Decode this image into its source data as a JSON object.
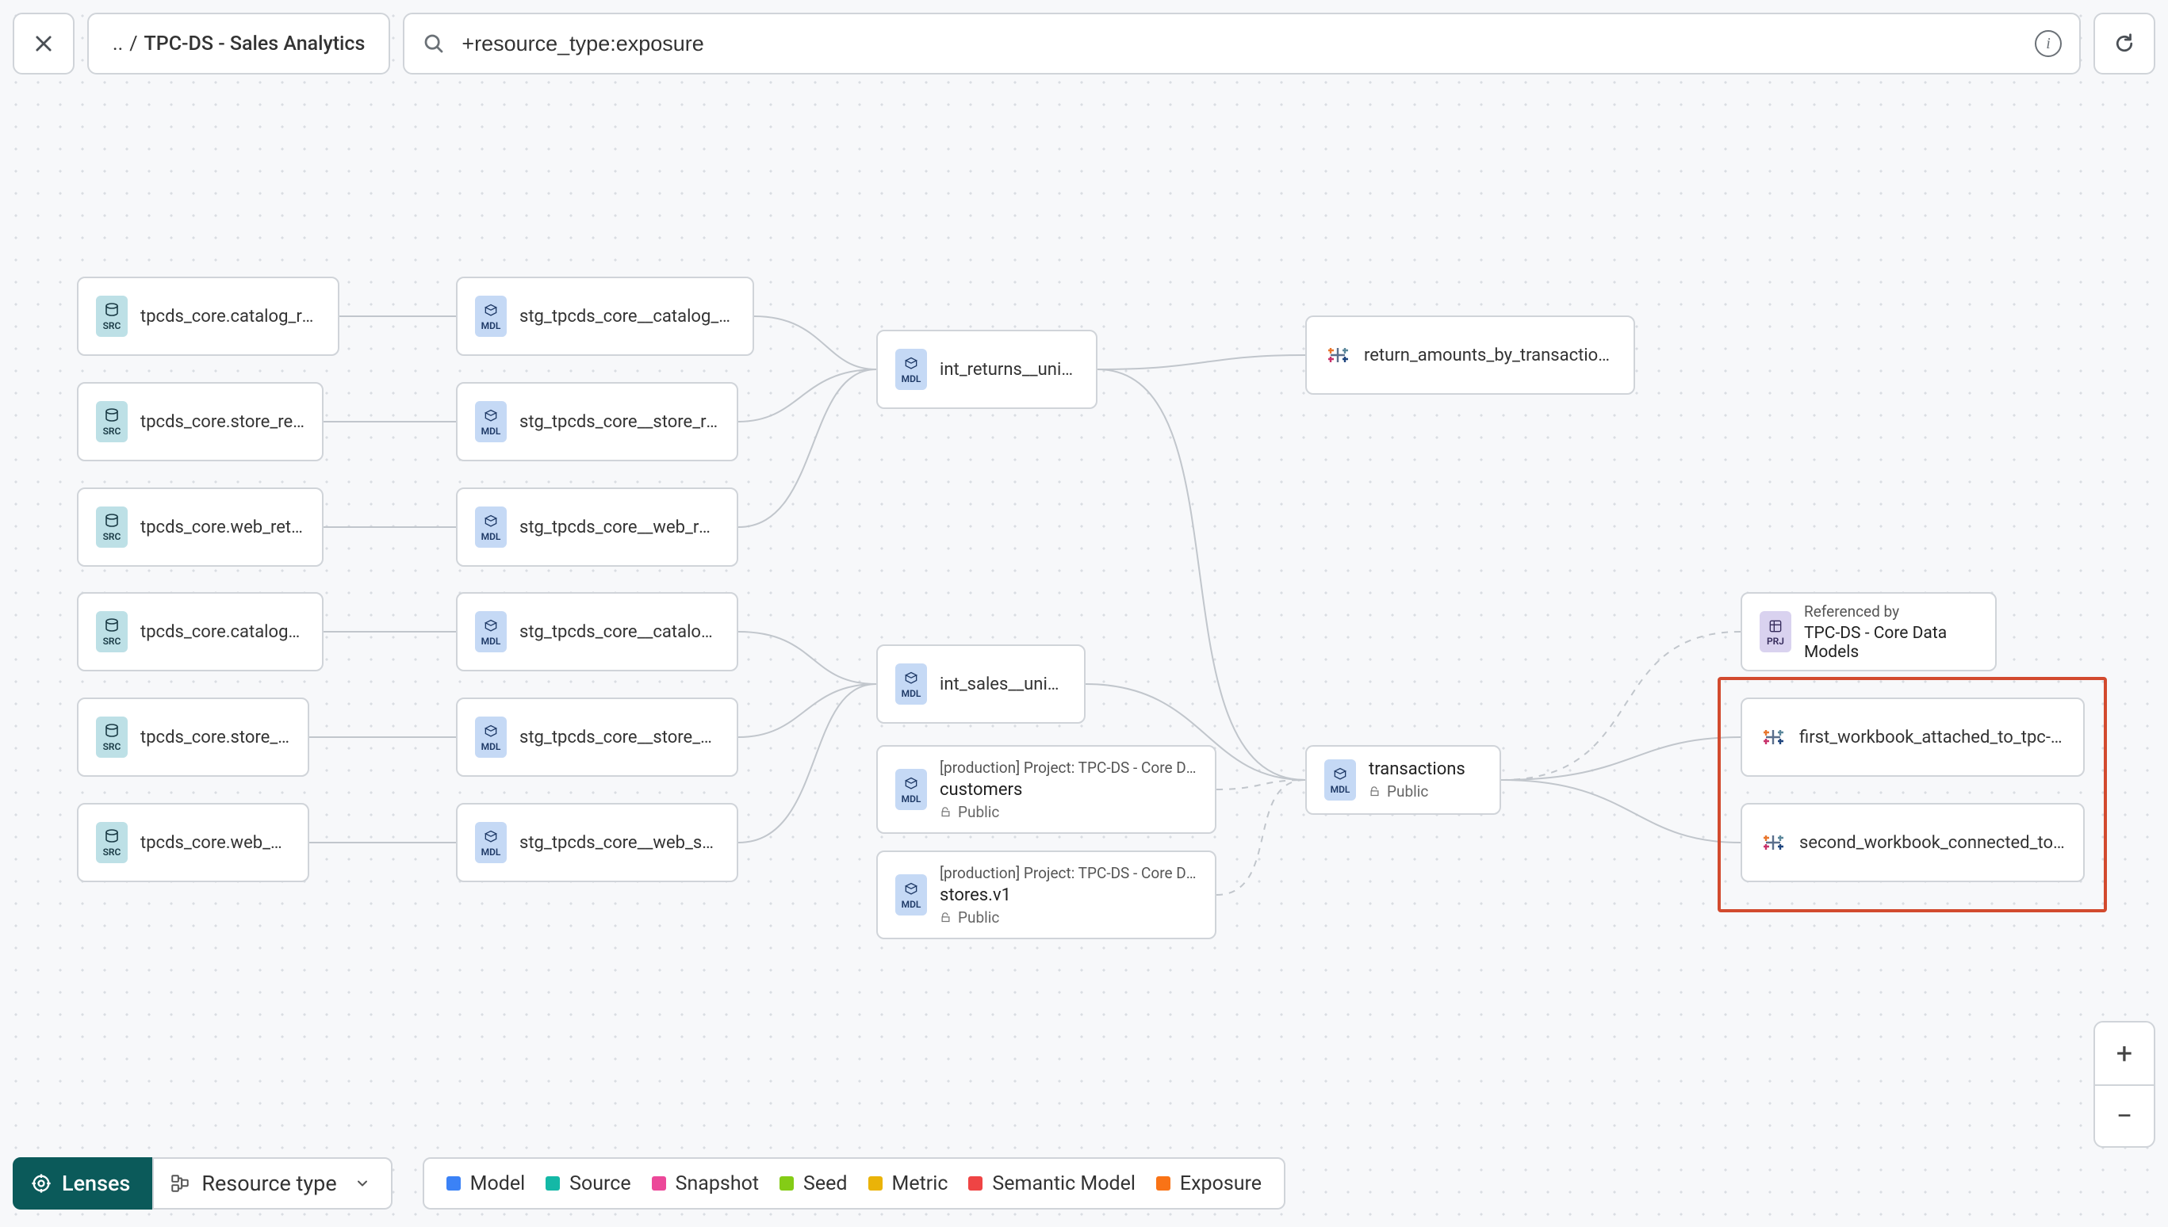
{
  "breadcrumb": {
    "prefix": "..",
    "sep": "/",
    "current": "TPC-DS - Sales Analytics"
  },
  "search": {
    "value": "+resource_type:exposure"
  },
  "badges": {
    "src": "SRC",
    "mdl": "MDL",
    "prj": "PRJ"
  },
  "sources": [
    {
      "label": "tpcds_core.catalog_returns"
    },
    {
      "label": "tpcds_core.store_returns"
    },
    {
      "label": "tpcds_core.web_returns"
    },
    {
      "label": "tpcds_core.catalog_sales"
    },
    {
      "label": "tpcds_core.store_sales"
    },
    {
      "label": "tpcds_core.web_sales"
    }
  ],
  "stg_models": [
    {
      "label": "stg_tpcds_core__catalog_returns"
    },
    {
      "label": "stg_tpcds_core__store_returns"
    },
    {
      "label": "stg_tpcds_core__web_returns"
    },
    {
      "label": "stg_tpcds_core__catalog_sales"
    },
    {
      "label": "stg_tpcds_core__store_sales"
    },
    {
      "label": "stg_tpcds_core__web_sales"
    }
  ],
  "int_models": {
    "returns": "int_returns__unioned",
    "sales": "int_sales__unioned"
  },
  "ext_models": {
    "customers": {
      "eyebrow": "[production] Project: TPC-DS - Core Data Mo…",
      "name": "customers",
      "access": "Public"
    },
    "stores": {
      "eyebrow": "[production] Project: TPC-DS - Core Data Mo…",
      "name": "stores.v1",
      "access": "Public"
    }
  },
  "transactions": {
    "name": "transactions",
    "access": "Public"
  },
  "exposures": {
    "return_amounts": "return_amounts_by_transaction_type",
    "wb1": "first_workbook_attached_to_tpc-ds_-_…",
    "wb2": "second_workbook_connected_to_live…"
  },
  "referenced": {
    "label": "Referenced by",
    "project": "TPC-DS - Core Data Models"
  },
  "legend": {
    "lenses": "Lenses",
    "resource_type": "Resource type",
    "items": [
      {
        "color": "#3b82f6",
        "label": "Model"
      },
      {
        "color": "#14b8a6",
        "label": "Source"
      },
      {
        "color": "#ec4899",
        "label": "Snapshot"
      },
      {
        "color": "#84cc16",
        "label": "Seed"
      },
      {
        "color": "#eab308",
        "label": "Metric"
      },
      {
        "color": "#ef4444",
        "label": "Semantic Model"
      },
      {
        "color": "#f97316",
        "label": "Exposure"
      }
    ]
  }
}
